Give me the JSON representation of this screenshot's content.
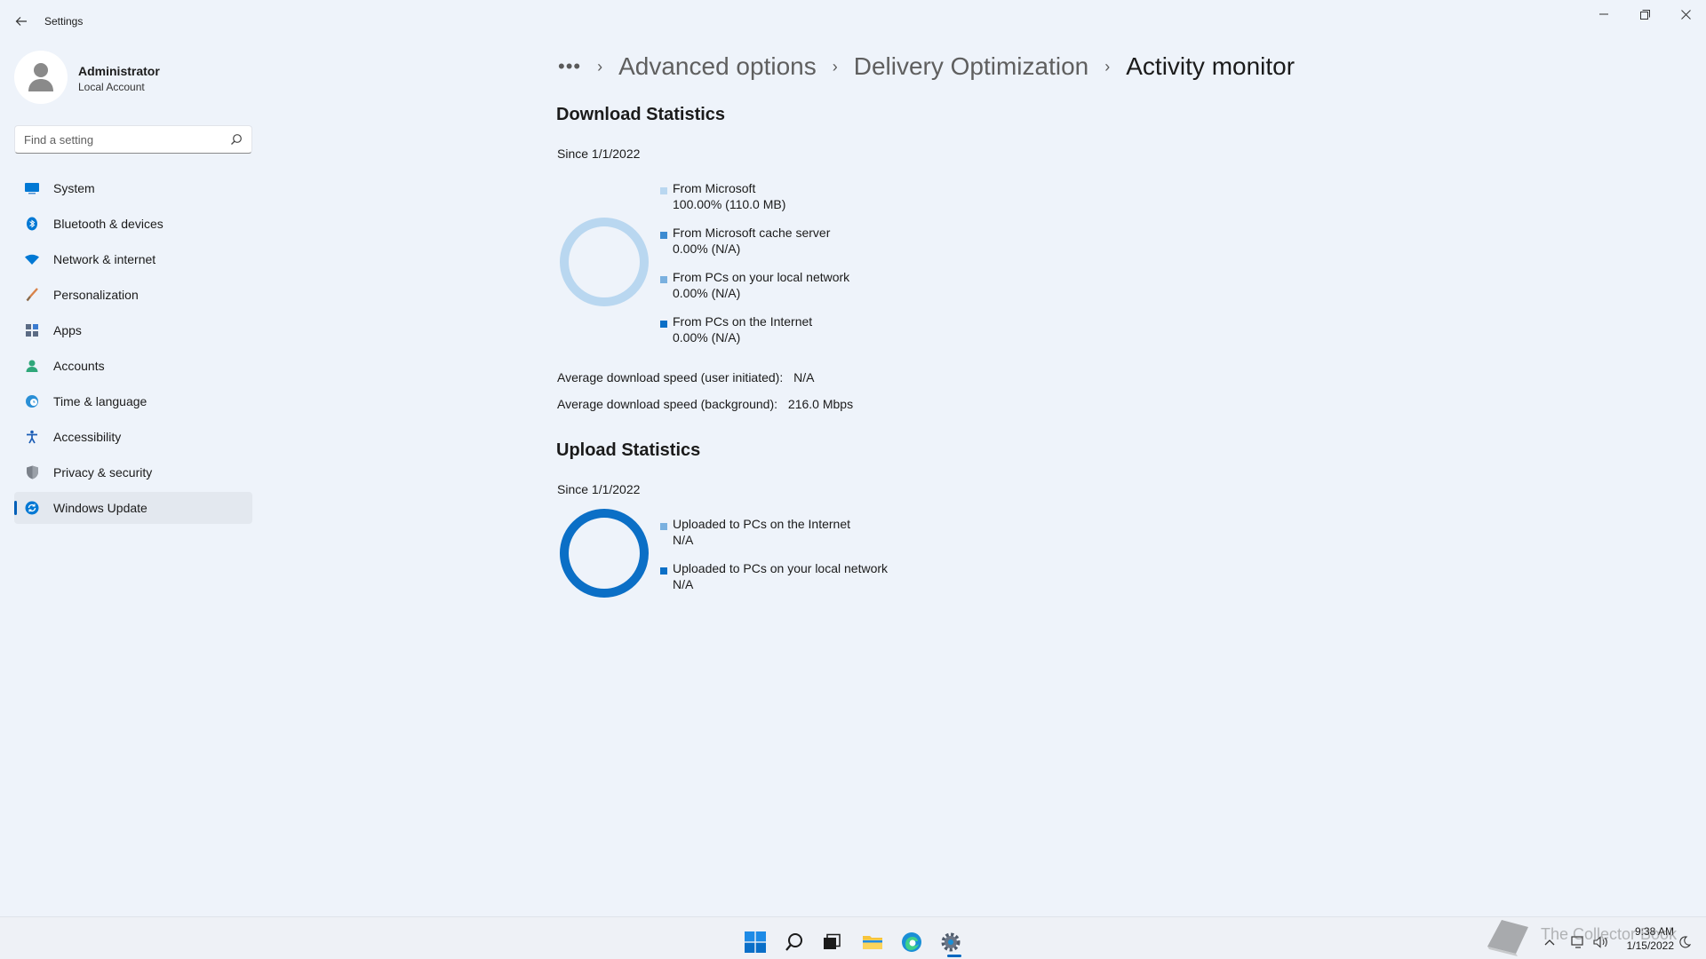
{
  "window": {
    "title": "Settings"
  },
  "profile": {
    "name": "Administrator",
    "account_type": "Local Account"
  },
  "search": {
    "placeholder": "Find a setting"
  },
  "sidebar": {
    "items": [
      {
        "label": "System",
        "icon": "system-icon",
        "color": "#0078d4"
      },
      {
        "label": "Bluetooth & devices",
        "icon": "bluetooth-icon",
        "color": "#0078d4"
      },
      {
        "label": "Network & internet",
        "icon": "wifi-icon",
        "color": "#0078d4"
      },
      {
        "label": "Personalization",
        "icon": "brush-icon",
        "color": "#e8823a"
      },
      {
        "label": "Apps",
        "icon": "apps-icon",
        "color": "#5b6b84"
      },
      {
        "label": "Accounts",
        "icon": "accounts-icon",
        "color": "#2fa77a"
      },
      {
        "label": "Time & language",
        "icon": "globe-clock-icon",
        "color": "#0078d4"
      },
      {
        "label": "Accessibility",
        "icon": "accessibility-icon",
        "color": "#1a5cb5"
      },
      {
        "label": "Privacy & security",
        "icon": "shield-icon",
        "color": "#6a6f78"
      },
      {
        "label": "Windows Update",
        "icon": "update-icon",
        "color": "#0078d4",
        "active": true
      }
    ]
  },
  "breadcrumb": {
    "more": "•••",
    "items": [
      "Advanced options",
      "Delivery Optimization"
    ],
    "current": "Activity monitor"
  },
  "download": {
    "title": "Download Statistics",
    "since": "Since 1/1/2022",
    "legend": [
      {
        "name": "From Microsoft",
        "value": "100.00%  (110.0 MB)",
        "color": "#b9d7f0"
      },
      {
        "name": "From Microsoft cache server",
        "value": "0.00%  (N/A)",
        "color": "#3d8bd1"
      },
      {
        "name": "From PCs on your local network",
        "value": "0.00%  (N/A)",
        "color": "#7ab0df"
      },
      {
        "name": "From PCs on the Internet",
        "value": "0.00%  (N/A)",
        "color": "#0b6fc6"
      }
    ],
    "avg_user_label": "Average download speed (user initiated):",
    "avg_user_value": "N/A",
    "avg_bg_label": "Average download speed (background):",
    "avg_bg_value": "216.0 Mbps"
  },
  "upload": {
    "title": "Upload Statistics",
    "since": "Since 1/1/2022",
    "legend": [
      {
        "name": "Uploaded to PCs on the Internet",
        "value": "N/A",
        "color": "#7ab0df"
      },
      {
        "name": "Uploaded to PCs on your local network",
        "value": "N/A",
        "color": "#0b6fc6"
      }
    ]
  },
  "taskbar": {
    "time": "9:38 AM",
    "date": "1/15/2022",
    "watermark": "The Collector Book"
  }
}
